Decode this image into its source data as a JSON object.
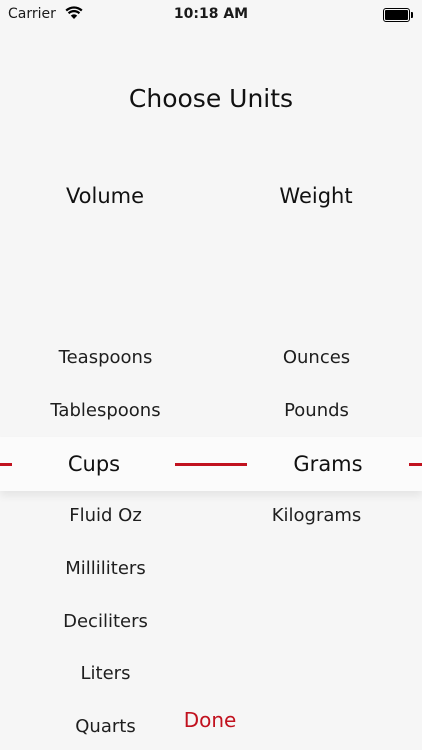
{
  "status_bar": {
    "carrier": "Carrier",
    "time": "10:18 AM",
    "wifi_icon": "wifi-icon",
    "battery_icon": "battery-icon"
  },
  "title": "Choose Units",
  "columns": {
    "left": {
      "header": "Volume",
      "items": [
        "Teaspoons",
        "Tablespoons",
        "Cups",
        "Fluid Oz",
        "Milliliters",
        "Deciliters",
        "Liters",
        "Quarts"
      ],
      "selected": "Cups"
    },
    "right": {
      "header": "Weight",
      "items": [
        "Ounces",
        "Pounds",
        "Grams",
        "Kilograms"
      ],
      "selected": "Grams"
    }
  },
  "done_label": "Done",
  "colors": {
    "accent": "#c1121f",
    "background": "#f6f6f6",
    "text": "#1a1a1a"
  }
}
